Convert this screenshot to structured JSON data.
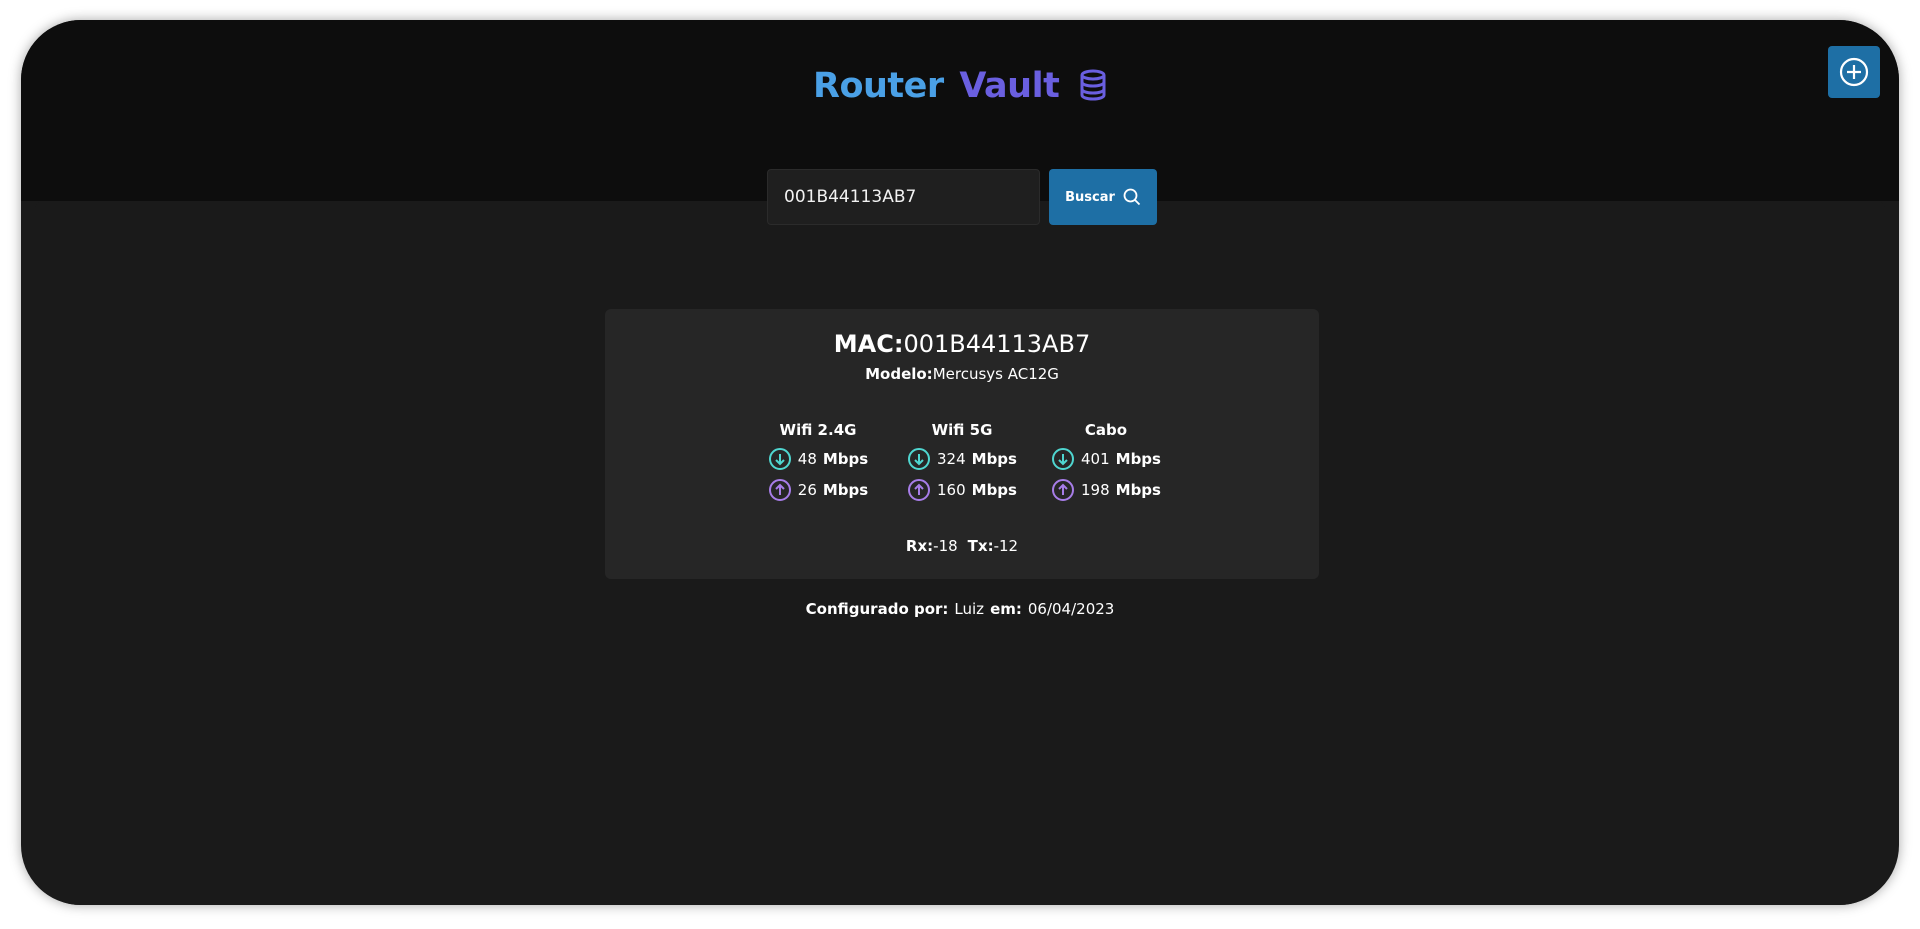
{
  "header": {
    "title_part1": "Router",
    "title_part2": "Vault",
    "title_icon": "database-icon",
    "add_button_icon": "plus-circle-icon"
  },
  "search": {
    "value": "001B44113AB7",
    "placeholder": "",
    "button_label": "Buscar",
    "button_icon": "search-icon"
  },
  "router": {
    "mac_label": "MAC:",
    "mac_value": "001B44113AB7",
    "modelo_label": "Modelo:",
    "modelo_value": "Mercusys AC12G",
    "speeds": [
      {
        "name": "Wifi 2.4G",
        "download": "48",
        "upload": "26",
        "unit": "Mbps"
      },
      {
        "name": "Wifi 5G",
        "download": "324",
        "upload": "160",
        "unit": "Mbps"
      },
      {
        "name": "Cabo",
        "download": "401",
        "upload": "198",
        "unit": "Mbps"
      }
    ],
    "rx_label": "Rx:",
    "rx_value": "-18",
    "tx_label": "Tx:",
    "tx_value": "-12"
  },
  "config": {
    "by_label": "Configurado por:",
    "by_value": "Luiz",
    "date_label": "em:",
    "date_value": "06/04/2023"
  },
  "colors": {
    "accent_blue": "#1e6fa5",
    "title_blue": "#4aa0e6",
    "title_purple": "#6a5fe0",
    "download_color": "#4fd6d0",
    "upload_color": "#a77de8"
  }
}
